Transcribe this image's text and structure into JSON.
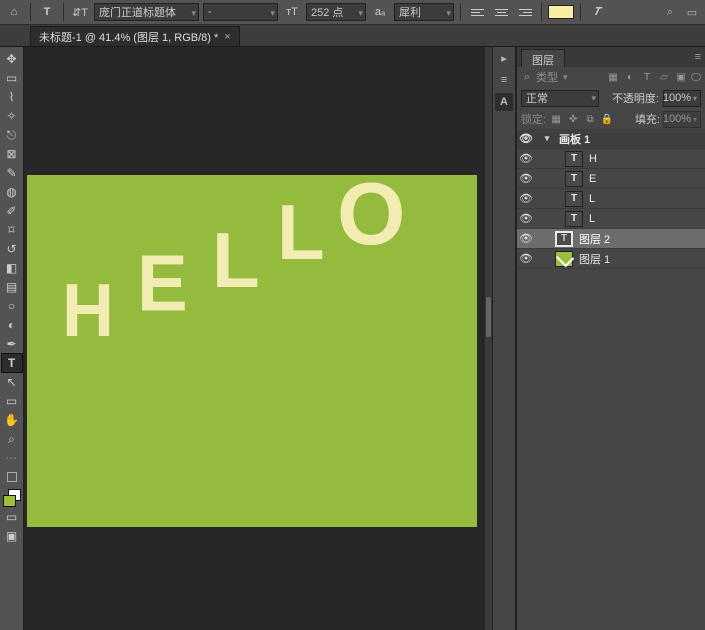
{
  "toolbar": {
    "home_icon": "⌂",
    "text_icon": "T",
    "orient_icon": "⇵T",
    "font_family": "庞门正道标题体",
    "font_style": "-",
    "size_icon": "тT",
    "font_size": "252 点",
    "aa_label": "aₐ",
    "aa_mode": "犀利",
    "align_left": "≡",
    "align_center": "≡",
    "align_right": "≡",
    "warp_icon": "𝑻",
    "search_icon": "⌕",
    "panel_icon": "▭"
  },
  "doc": {
    "tab_title": "未标题-1 @ 41.4% (图层 1, RGB/8) *",
    "close": "×"
  },
  "canvas": {
    "letters": {
      "h": "H",
      "e": "E",
      "l1": "L",
      "l2": "L",
      "o": "O"
    }
  },
  "sidestrip": {
    "a": "▸",
    "b": "≡",
    "c": "A"
  },
  "panel": {
    "tab": "图层",
    "menu": "≡",
    "filter_label": "类型",
    "blend_mode": "正常",
    "opacity_label": "不透明度:",
    "opacity_val": "100%",
    "lock_label": "锁定:",
    "fill_label": "填充:",
    "fill_val": "100%"
  },
  "layers": {
    "artboard": "画板 1",
    "h": "H",
    "e": "E",
    "l1": "L",
    "l2": "L",
    "layer2": "图层 2",
    "layer1": "图层 1",
    "t_glyph": "T"
  },
  "tools": {
    "move": "✥",
    "marq": "▭",
    "lasso": "⌇",
    "wand": "✧",
    "crop": "⎋",
    "frame": "⊠",
    "eyedrop": "✎",
    "heal": "◍",
    "brush": "✐",
    "stamp": "⌑",
    "history": "↺",
    "eraser": "◧",
    "grad": "▤",
    "blur": "○",
    "dodge": "◐",
    "pen": "✒",
    "type": "T",
    "path": "↖",
    "shape": "▭",
    "hand": "✋",
    "zoom": "⌕",
    "dots": "⋯",
    "mask": "▭",
    "qm": "▭",
    "screen": "▣"
  }
}
